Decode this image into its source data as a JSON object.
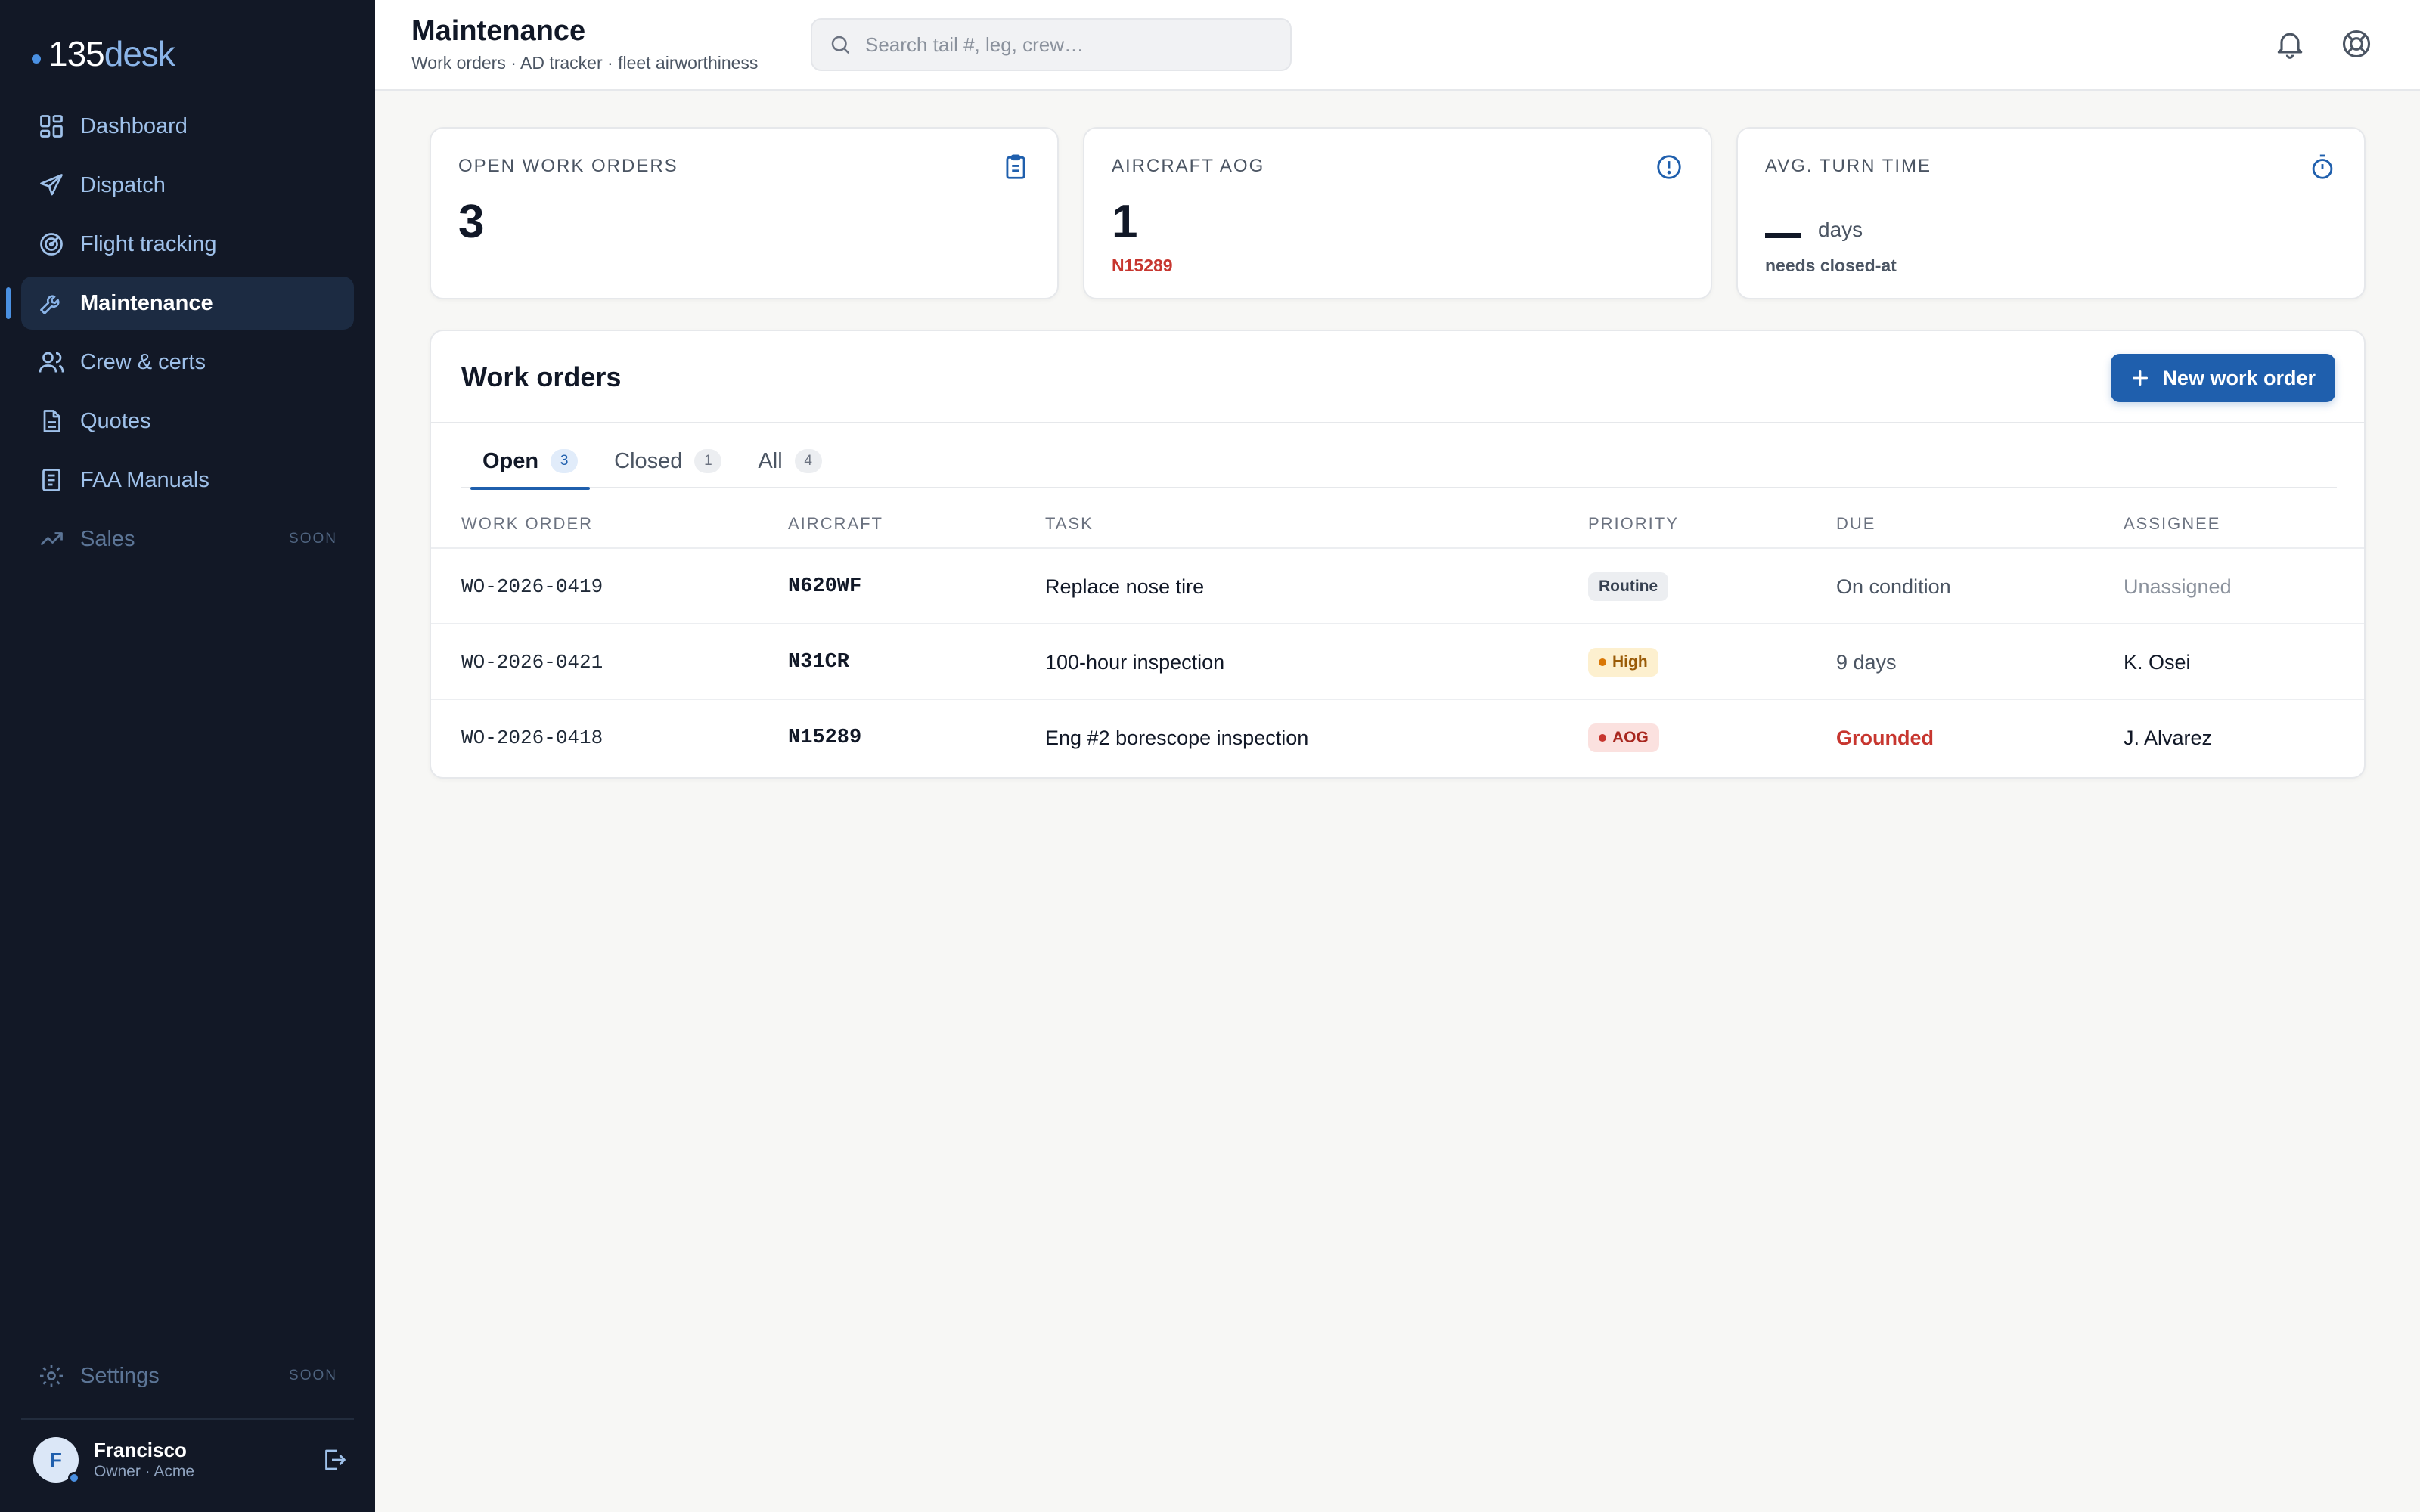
{
  "brand": {
    "num": "135",
    "word": "desk"
  },
  "nav": {
    "dashboard": "Dashboard",
    "dispatch": "Dispatch",
    "flight_tracking": "Flight tracking",
    "maintenance": "Maintenance",
    "crew": "Crew & certs",
    "quotes": "Quotes",
    "faa_manuals": "FAA Manuals",
    "sales": "Sales",
    "sales_badge": "SOON",
    "settings": "Settings",
    "settings_badge": "SOON"
  },
  "user": {
    "initial": "F",
    "name": "Francisco",
    "role": "Owner · Acme"
  },
  "header": {
    "title": "Maintenance",
    "subtitle": "Work orders · AD tracker · fleet airworthiness",
    "search_placeholder": "Search tail #, leg, crew…"
  },
  "stats": {
    "open": {
      "label": "OPEN WORK ORDERS",
      "value": "3"
    },
    "aog": {
      "label": "AIRCRAFT AOG",
      "value": "1",
      "sub": "N15289"
    },
    "turn": {
      "label": "AVG. TURN TIME",
      "unit": "days",
      "sub": "needs closed-at"
    }
  },
  "panel": {
    "title": "Work orders",
    "new_button": "New work order",
    "tabs": [
      {
        "label": "Open",
        "count": "3"
      },
      {
        "label": "Closed",
        "count": "1"
      },
      {
        "label": "All",
        "count": "4"
      }
    ],
    "columns": {
      "work_order": "WORK ORDER",
      "aircraft": "AIRCRAFT",
      "task": "TASK",
      "priority": "PRIORITY",
      "due": "DUE",
      "assignee": "ASSIGNEE"
    },
    "rows": [
      {
        "id": "WO-2026-0419",
        "aircraft": "N620WF",
        "task": "Replace nose tire",
        "priority": "Routine",
        "due": "On condition",
        "assignee": "Unassigned"
      },
      {
        "id": "WO-2026-0421",
        "aircraft": "N31CR",
        "task": "100-hour inspection",
        "priority": "High",
        "due": "9 days",
        "assignee": "K. Osei"
      },
      {
        "id": "WO-2026-0418",
        "aircraft": "N15289",
        "task": "Eng #2 borescope inspection",
        "priority": "AOG",
        "due": "Grounded",
        "assignee": "J. Alvarez"
      }
    ]
  },
  "colors": {
    "sidebar_bg": "#121826",
    "accent": "#1f5fad",
    "danger": "#c7362f",
    "high": "#d97706"
  }
}
